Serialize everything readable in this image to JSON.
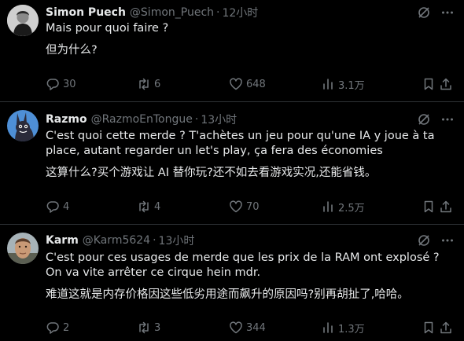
{
  "tweets": [
    {
      "name": "Simon Puech",
      "handle": "@Simon_Puech",
      "separator": "·",
      "time": "12小时",
      "text": "Mais pour quoi faire ?",
      "translation": "但为什么?",
      "replies": "30",
      "retweets": "6",
      "likes": "648",
      "views": "3.1万",
      "avatar_icon": "profile-photo"
    },
    {
      "name": "Razmo",
      "handle": "@RazmoEnTongue",
      "separator": "·",
      "time": "13小时",
      "text": "C'est quoi cette merde ? T'achètes un jeu pour qu'une IA y joue à ta place, autant regarder un let's play, ça fera des économies",
      "translation": "这算什么?买个游戏让 AI 替你玩?还不如去看游戏实况,还能省钱。",
      "replies": "4",
      "retweets": "4",
      "likes": "70",
      "views": "2.5万",
      "avatar_icon": "rabbit-avatar"
    },
    {
      "name": "Karm",
      "handle": "@Karm5624",
      "separator": "·",
      "time": "13小时",
      "text": "C'est pour ces usages de merde que les prix de la RAM ont explosé ? On va vite arrêter ce cirque hein mdr.",
      "translation": "难道这就是内存价格因这些低劣用途而飙升的原因吗?别再胡扯了,哈哈。",
      "replies": "2",
      "retweets": "3",
      "likes": "344",
      "views": "1.3万",
      "avatar_icon": "face-avatar"
    }
  ],
  "colors": {
    "background": "#000000",
    "text": "#e7e9ea",
    "muted": "#71767b",
    "divider": "#2f3336"
  }
}
